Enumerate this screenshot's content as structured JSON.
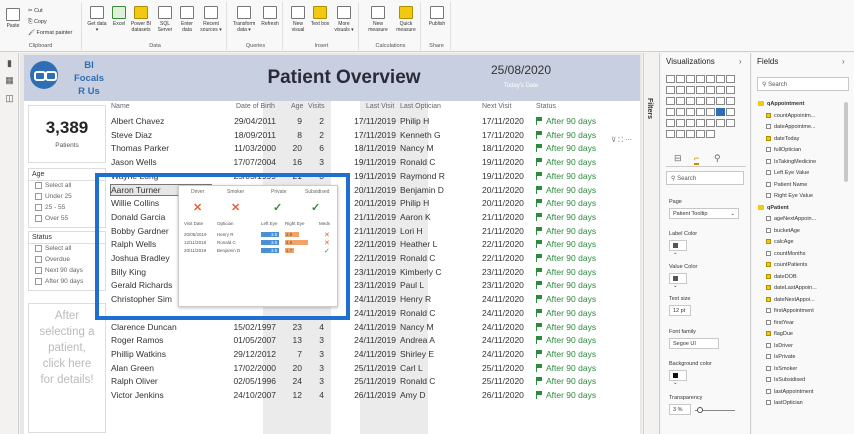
{
  "ribbon": {
    "clipboard": {
      "paste": "Paste",
      "cut": "Cut",
      "copy": "Copy",
      "format_painter": "Format painter",
      "group": "Clipboard"
    },
    "data": {
      "group": "Data",
      "buttons": [
        "Get data ▾",
        "Excel",
        "Power BI datasets",
        "SQL Server",
        "Enter data",
        "Recent sources ▾"
      ]
    },
    "queries": {
      "group": "Queries",
      "buttons": [
        "Transform data ▾",
        "Refresh"
      ]
    },
    "insert": {
      "group": "Insert",
      "buttons": [
        "New visual",
        "Text box",
        "More visuals ▾"
      ]
    },
    "calculations": {
      "group": "Calculations",
      "buttons": [
        "New measure",
        "Quick measure"
      ]
    },
    "share": {
      "group": "Share",
      "buttons": [
        "Publish"
      ]
    }
  },
  "report": {
    "logo_text": [
      "BI",
      "Focals",
      "R Us"
    ],
    "title": "Patient Overview",
    "date": "25/08/2020",
    "date_label": "Today's Date",
    "kpi_value": "3,389",
    "kpi_label": "Patients",
    "age_slicer": {
      "title": "Age",
      "items": [
        "Select all",
        "Under 25",
        "25 - 55",
        "Over 55"
      ]
    },
    "status_slicer": {
      "title": "Status",
      "items": [
        "Select all",
        "Overdue",
        "Next 90 days",
        "After 90 days"
      ]
    },
    "hint_text": [
      "After",
      "selecting a",
      "patient,",
      "click here",
      "for details!"
    ]
  },
  "table": {
    "headers": [
      "Name",
      "Date of Birth",
      "Age",
      "Visits",
      "Last Visit",
      "Last Optician",
      "Next Visit",
      "Status"
    ],
    "rows": [
      [
        "Albert Chavez",
        "29/04/2011",
        "9",
        "2",
        "17/11/2019",
        "Philip H",
        "17/11/2020",
        "After 90 days"
      ],
      [
        "Steve Diaz",
        "18/09/2011",
        "8",
        "2",
        "17/11/2019",
        "Kenneth G",
        "17/11/2020",
        "After 90 days"
      ],
      [
        "Thomas Parker",
        "11/03/2000",
        "20",
        "6",
        "18/11/2019",
        "Nancy M",
        "18/11/2020",
        "After 90 days"
      ],
      [
        "Jason Wells",
        "17/07/2004",
        "16",
        "3",
        "19/11/2019",
        "Ronald C",
        "19/11/2020",
        "After 90 days"
      ],
      [
        "Wayne Long",
        "25/05/1999",
        "21",
        "3",
        "19/11/2019",
        "Raymond R",
        "19/11/2020",
        "After 90 days"
      ],
      [
        "Aaron Turner",
        "",
        "",
        "",
        "20/11/2019",
        "Benjamin D",
        "20/11/2020",
        "After 90 days"
      ],
      [
        "Willie Collins",
        "",
        "",
        "",
        "20/11/2019",
        "Philip H",
        "20/11/2020",
        "After 90 days"
      ],
      [
        "Donald Garcia",
        "",
        "",
        "",
        "21/11/2019",
        "Aaron K",
        "21/11/2020",
        "After 90 days"
      ],
      [
        "Bobby Gardner",
        "",
        "",
        "",
        "21/11/2019",
        "Lori H",
        "21/11/2020",
        "After 90 days"
      ],
      [
        "Ralph Wells",
        "",
        "",
        "",
        "22/11/2019",
        "Heather L",
        "22/11/2020",
        "After 90 days"
      ],
      [
        "Joshua Bradley",
        "",
        "",
        "",
        "22/11/2019",
        "Ronald C",
        "22/11/2020",
        "After 90 days"
      ],
      [
        "Billy King",
        "",
        "",
        "",
        "23/11/2019",
        "Kimberly C",
        "23/11/2020",
        "After 90 days"
      ],
      [
        "Gerald Richards",
        "",
        "",
        "",
        "23/11/2019",
        "Paul L",
        "23/11/2020",
        "After 90 days"
      ],
      [
        "Christopher Sim",
        "",
        "",
        "",
        "24/11/2019",
        "Henry R",
        "24/11/2020",
        "After 90 days"
      ],
      [
        "",
        "",
        "",
        "",
        "24/11/2019",
        "Ronald C",
        "24/11/2020",
        "After 90 days"
      ],
      [
        "Clarence Duncan",
        "15/02/1997",
        "23",
        "4",
        "24/11/2019",
        "Nancy M",
        "24/11/2020",
        "After 90 days"
      ],
      [
        "Roger Ramos",
        "01/05/2007",
        "13",
        "3",
        "24/11/2019",
        "Andrea A",
        "24/11/2020",
        "After 90 days"
      ],
      [
        "Phillip Watkins",
        "29/12/2012",
        "7",
        "3",
        "24/11/2019",
        "Shirley E",
        "24/11/2020",
        "After 90 days"
      ],
      [
        "Alan Green",
        "17/02/2000",
        "20",
        "3",
        "25/11/2019",
        "Carl L",
        "25/11/2020",
        "After 90 days"
      ],
      [
        "Ralph Oliver",
        "02/05/1996",
        "24",
        "3",
        "25/11/2019",
        "Ronald C",
        "25/11/2020",
        "After 90 days"
      ],
      [
        "Victor Jenkins",
        "24/10/2007",
        "12",
        "4",
        "26/11/2019",
        "Amy D",
        "26/11/2020",
        "After 90 days"
      ]
    ]
  },
  "tooltip": {
    "headers": [
      "Driver",
      "Smoker",
      "Private",
      "Subsidised"
    ],
    "icons": [
      "✕",
      "✕",
      "✓",
      "✓"
    ],
    "table_headers": [
      "Visit Date",
      "Optician",
      "Left Eye",
      "Right Eye",
      "Meds"
    ],
    "rows": [
      {
        "date": "20/05/2019",
        "optician": "Henry R",
        "left": "3.5",
        "right": "2.8",
        "meds": "✕"
      },
      {
        "date": "12/11/2018",
        "optician": "Ronald C",
        "left": "3.5",
        "right": "4.6",
        "meds": "✕"
      },
      {
        "date": "20/11/2019",
        "optician": "Benjamin D",
        "left": "3.5",
        "right": "1.7",
        "meds": "✓"
      }
    ]
  },
  "filters_label": "Filters",
  "visualizations": {
    "title": "Visualizations",
    "search_placeholder": "Search",
    "page_label": "Page",
    "page_value": "Patient Tooltip",
    "label_color": "Label Color",
    "value_color": "Value Color",
    "text_size": "Text size",
    "text_size_value": "12",
    "text_size_unit": "pt",
    "font_family": "Font family",
    "font_value": "Segoe UI",
    "bg_color": "Background color",
    "transparency": "Transparency",
    "transparency_value": "3",
    "transparency_unit": "%"
  },
  "fields": {
    "title": "Fields",
    "search_placeholder": "Search",
    "items": [
      {
        "label": "qAppointment",
        "kind": "table"
      },
      {
        "label": "countAppointm...",
        "kind": "checked"
      },
      {
        "label": "dateAppointme...",
        "kind": "unchecked"
      },
      {
        "label": "dateToday",
        "kind": "checked"
      },
      {
        "label": "fullOptician",
        "kind": "unchecked"
      },
      {
        "label": "IsTakingMedicine",
        "kind": "unchecked"
      },
      {
        "label": "Left Eye Value",
        "kind": "unchecked"
      },
      {
        "label": "Patient Name",
        "kind": "unchecked"
      },
      {
        "label": "Right Eye Value",
        "kind": "unchecked"
      },
      {
        "label": "qPatient",
        "kind": "table"
      },
      {
        "label": "ageNextAppoin...",
        "kind": "unchecked"
      },
      {
        "label": "bucketAge",
        "kind": "unchecked"
      },
      {
        "label": "calcAge",
        "kind": "checked"
      },
      {
        "label": "countMonths",
        "kind": "unchecked"
      },
      {
        "label": "countPatients",
        "kind": "checked"
      },
      {
        "label": "dateDOB",
        "kind": "checked"
      },
      {
        "label": "dateLastAppoin...",
        "kind": "checked"
      },
      {
        "label": "dateNextAppoi...",
        "kind": "checked"
      },
      {
        "label": "firstAppointment",
        "kind": "unchecked"
      },
      {
        "label": "firstYear",
        "kind": "unchecked"
      },
      {
        "label": "flagDue",
        "kind": "checked"
      },
      {
        "label": "IsDriver",
        "kind": "unchecked"
      },
      {
        "label": "IsPrivate",
        "kind": "unchecked"
      },
      {
        "label": "IsSmoker",
        "kind": "unchecked"
      },
      {
        "label": "IsSubsidised",
        "kind": "unchecked"
      },
      {
        "label": "lastAppointment",
        "kind": "unchecked"
      },
      {
        "label": "lastOptician",
        "kind": "unchecked"
      }
    ]
  },
  "colors": {
    "accent": "#1f6fd1",
    "status_green": "#2e8b3e",
    "header_bg": "#c8cfe0"
  }
}
